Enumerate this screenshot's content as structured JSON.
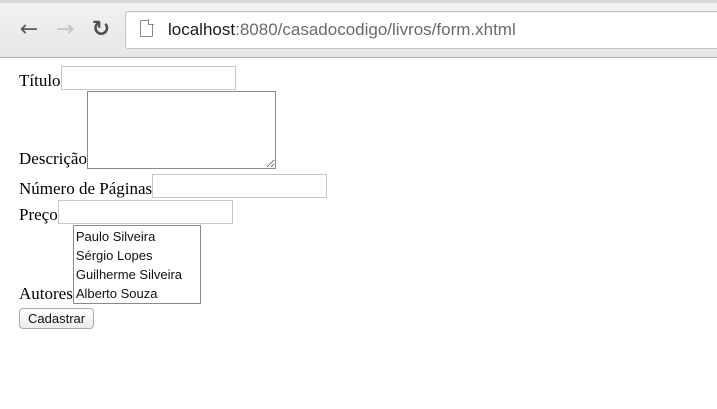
{
  "browser": {
    "back_icon": "arrow-left-icon",
    "forward_icon": "arrow-right-icon",
    "reload_icon": "reload-icon",
    "page_icon": "page-icon",
    "url_host": "localhost",
    "url_rest": ":8080/casadocodigo/livros/form.xhtml"
  },
  "form": {
    "titulo_label": "Título",
    "titulo_value": "",
    "descricao_label": "Descrição",
    "descricao_value": "",
    "paginas_label": "Número de Páginas",
    "paginas_value": "",
    "preco_label": "Preço",
    "preco_value": "",
    "autores_label": "Autores",
    "autores_options": [
      "Paulo Silveira",
      "Sérgio Lopes",
      "Guilherme Silveira",
      "Alberto Souza"
    ],
    "submit_label": "Cadastrar"
  }
}
